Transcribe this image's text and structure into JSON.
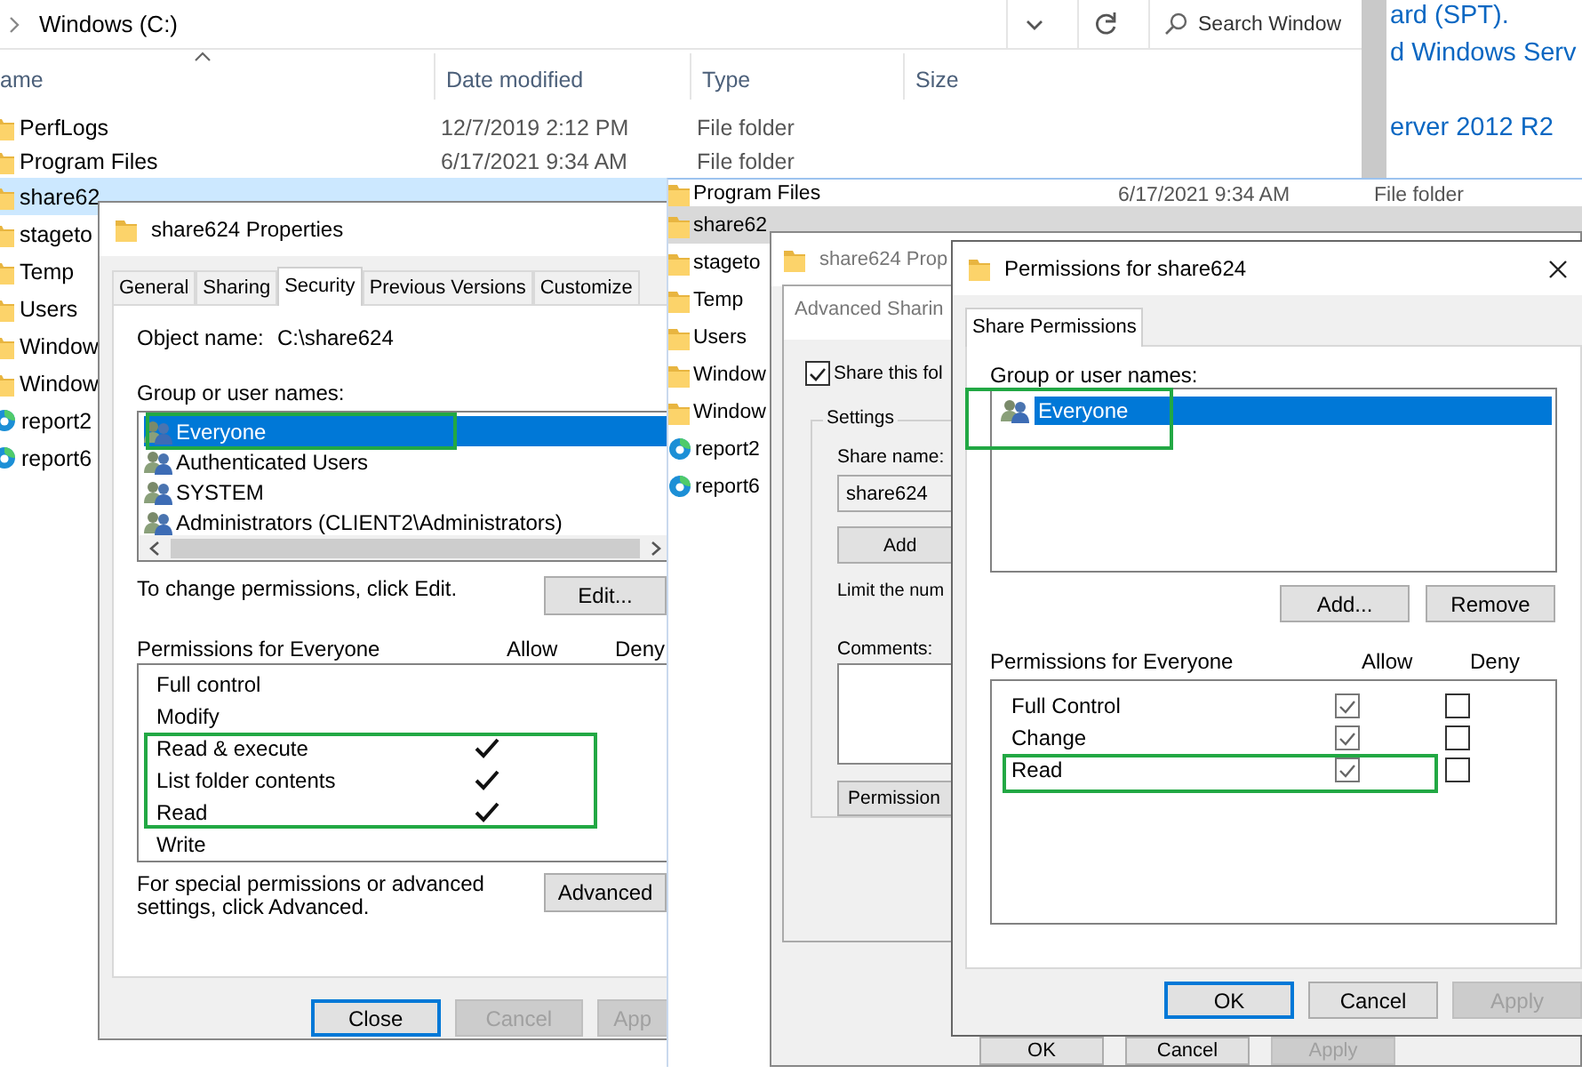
{
  "explorer": {
    "breadcrumb": "Windows (C:)",
    "search": {
      "placeholder": "Search Window"
    },
    "columns": [
      "ame",
      "Date modified",
      "Type",
      "Size"
    ],
    "rows": [
      {
        "name": "PerfLogs",
        "date": "12/7/2019 2:12 PM",
        "type": "File folder",
        "kind": "folder",
        "selected": false
      },
      {
        "name": "Program Files",
        "date": "6/17/2021 9:34 AM",
        "type": "File folder",
        "kind": "folder",
        "selected": false
      },
      {
        "name": "share62",
        "kind": "folder",
        "selected": true
      },
      {
        "name": "stageto",
        "kind": "folder",
        "selected": false
      },
      {
        "name": "Temp",
        "kind": "folder",
        "selected": false
      },
      {
        "name": "Users",
        "kind": "folder",
        "selected": false
      },
      {
        "name": "Window",
        "kind": "folder",
        "selected": false
      },
      {
        "name": "Window",
        "kind": "folder",
        "selected": false
      },
      {
        "name": "report2",
        "kind": "web",
        "selected": false
      },
      {
        "name": "report6",
        "kind": "web",
        "selected": false
      }
    ]
  },
  "web_page": {
    "lines": [
      "ard (SPT).",
      "d Windows Serv",
      "erver 2012 R2"
    ]
  },
  "explorer_2": {
    "rows": [
      {
        "name": "Program Files",
        "date": "6/17/2021 9:34 AM",
        "type": "File folder",
        "kind": "folder",
        "selected": false
      },
      {
        "name": "share62",
        "kind": "folder",
        "selected": true
      },
      {
        "name": "stageto",
        "kind": "folder",
        "selected": false
      },
      {
        "name": "Temp",
        "kind": "folder",
        "selected": false
      },
      {
        "name": "Users",
        "kind": "folder",
        "selected": false
      },
      {
        "name": "Window",
        "kind": "folder",
        "selected": false
      },
      {
        "name": "Window",
        "kind": "folder",
        "selected": false
      },
      {
        "name": "report2",
        "kind": "web",
        "selected": false
      },
      {
        "name": "report6",
        "kind": "web",
        "selected": false
      }
    ]
  },
  "properties_dialog": {
    "title": "share624 Properties",
    "tabs": [
      {
        "label": "General",
        "selected": false
      },
      {
        "label": "Sharing",
        "selected": false
      },
      {
        "label": "Security",
        "selected": true
      },
      {
        "label": "Previous Versions",
        "selected": false
      },
      {
        "label": "Customize",
        "selected": false
      }
    ],
    "object_name_label": "Object name:",
    "object_name": "C:\\share624",
    "group_label": "Group or user names:",
    "principals": [
      {
        "name": "Everyone",
        "selected": true
      },
      {
        "name": "Authenticated Users",
        "selected": false
      },
      {
        "name": "SYSTEM",
        "selected": false
      },
      {
        "name": "Administrators (CLIENT2\\Administrators)",
        "selected": false
      }
    ],
    "change_hint": "To change permissions, click Edit.",
    "edit_button": "Edit...",
    "permissions_label": "Permissions for Everyone",
    "allow_label": "Allow",
    "deny_label": "Deny",
    "permissions": [
      {
        "name": "Full control",
        "allow": false,
        "deny": false
      },
      {
        "name": "Modify",
        "allow": false,
        "deny": false
      },
      {
        "name": "Read & execute",
        "allow": true,
        "deny": false
      },
      {
        "name": "List folder contents",
        "allow": true,
        "deny": false
      },
      {
        "name": "Read",
        "allow": true,
        "deny": false
      },
      {
        "name": "Write",
        "allow": false,
        "deny": false
      }
    ],
    "advanced_hint": "For special permissions or advanced settings, click Advanced.",
    "advanced_button": "Advanced",
    "buttons": [
      {
        "label": "Close",
        "default": true,
        "disabled": false
      },
      {
        "label": "Cancel",
        "default": false,
        "disabled": true
      },
      {
        "label": "App",
        "default": false,
        "disabled": true
      }
    ]
  },
  "sharing_dialog": {
    "title": "share624 Prop",
    "buttons": [
      {
        "label": "OK",
        "disabled": false
      },
      {
        "label": "Cancel",
        "disabled": false
      },
      {
        "label": "Apply",
        "disabled": true
      }
    ]
  },
  "advanced_sharing": {
    "title": "Advanced Sharin",
    "share_checkbox": {
      "label": "Share this fol",
      "checked": true
    },
    "settings_label": "Settings",
    "share_name_label": "Share name:",
    "share_name": "share624",
    "add_button": "Add",
    "limit_text": "Limit the num",
    "comments_label": "Comments:",
    "permissions_button": "Permission"
  },
  "permissions_dialog": {
    "title": "Permissions for share624",
    "tabs": [
      {
        "label": "Share Permissions",
        "selected": true
      }
    ],
    "group_label": "Group or user names:",
    "principals": [
      {
        "name": "Everyone",
        "selected": true
      }
    ],
    "add_button": "Add...",
    "remove_button": "Remove",
    "permissions_label": "Permissions for Everyone",
    "allow_label": "Allow",
    "deny_label": "Deny",
    "permissions": [
      {
        "name": "Full Control",
        "allow": true,
        "deny": false
      },
      {
        "name": "Change",
        "allow": true,
        "deny": false
      },
      {
        "name": "Read",
        "allow": true,
        "deny": false
      }
    ],
    "buttons": [
      {
        "label": "OK",
        "default": true,
        "disabled": false
      },
      {
        "label": "Cancel",
        "default": false,
        "disabled": false
      },
      {
        "label": "Apply",
        "default": false,
        "disabled": true
      }
    ]
  }
}
